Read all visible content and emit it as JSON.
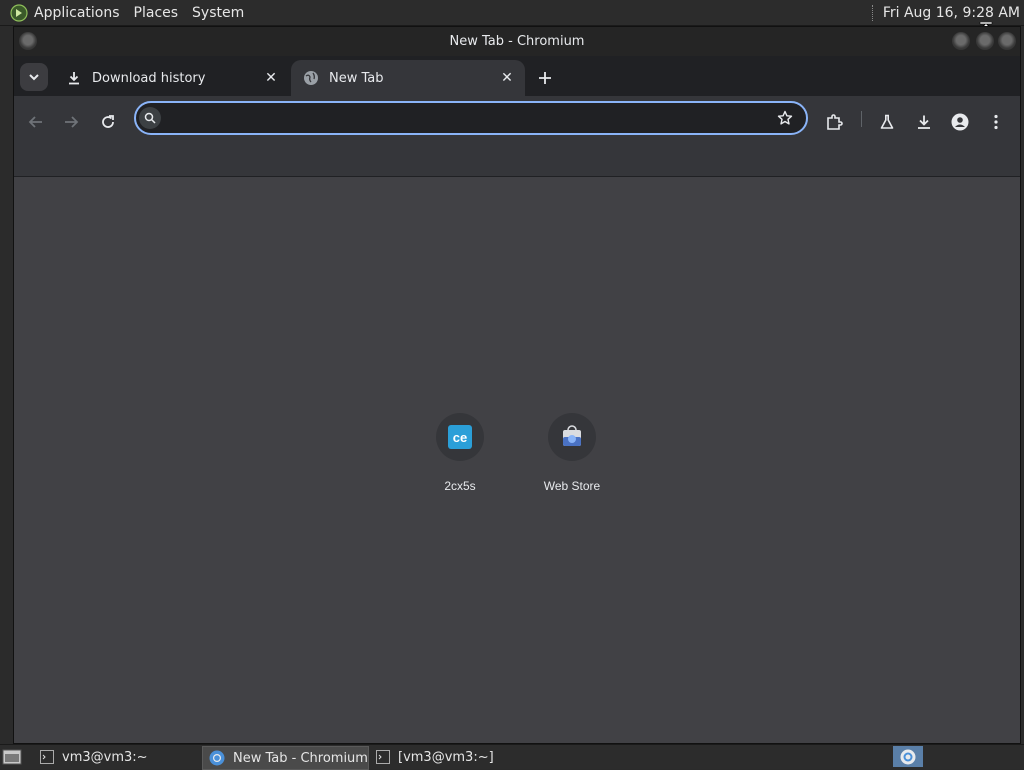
{
  "top_panel": {
    "menus": [
      "Applications",
      "Places",
      "System"
    ],
    "clock": "Fri Aug 16,  9:28 AM"
  },
  "window": {
    "title": "New Tab - Chromium"
  },
  "tabs": [
    {
      "title": "Download history",
      "icon": "download-icon",
      "active": false
    },
    {
      "title": "New Tab",
      "icon": "globe-icon",
      "active": true
    }
  ],
  "toolbar": {
    "omnibox_value": "",
    "omnibox_placeholder": ""
  },
  "shortcuts": [
    {
      "label": "2cx5s",
      "icon": "ce-logo-icon"
    },
    {
      "label": "Web Store",
      "icon": "web-store-icon"
    }
  ],
  "taskbar": {
    "items": [
      {
        "label": "vm3@vm3:~",
        "icon": "terminal-icon",
        "active": false
      },
      {
        "label": "New Tab - Chromium",
        "icon": "chromium-icon",
        "active": true
      },
      {
        "label": "[vm3@vm3:~]",
        "icon": "terminal-icon",
        "active": false
      }
    ]
  },
  "colors": {
    "accent": "#8ab4f8",
    "content_bg": "#414145",
    "toolbar_bg": "#35363a",
    "tabstrip_bg": "#202124"
  }
}
